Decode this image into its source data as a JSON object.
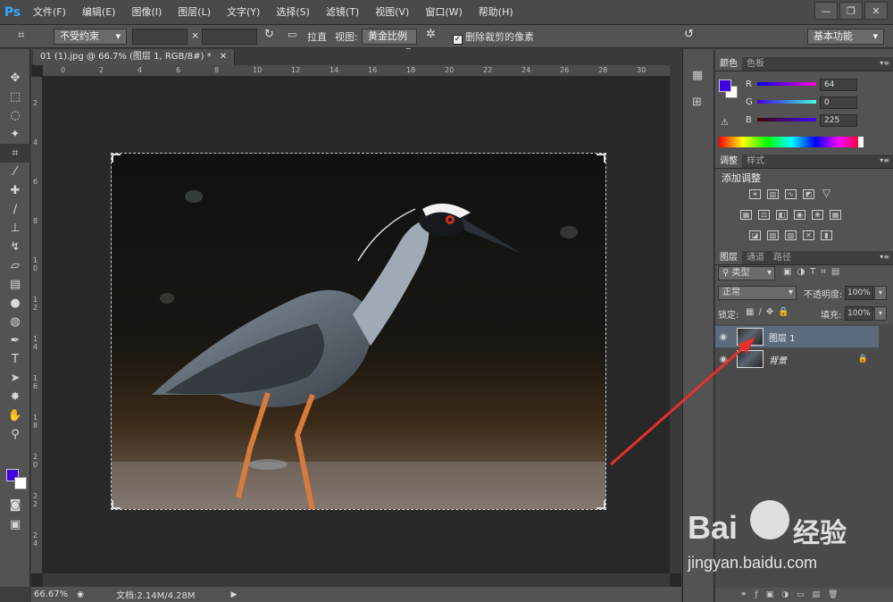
{
  "menubar": {
    "logo": "Ps",
    "items": [
      "文件(F)",
      "编辑(E)",
      "图像(I)",
      "图层(L)",
      "文字(Y)",
      "选择(S)",
      "滤镜(T)",
      "视图(V)",
      "窗口(W)",
      "帮助(H)"
    ],
    "win_minimize": "—",
    "win_restore": "❐",
    "win_close": "✕"
  },
  "options": {
    "ratio_select": "不受约束",
    "x_sep": "×",
    "straighten_label": "拉直",
    "view_label": "视图:",
    "view_select": "黄金比例",
    "delete_pixels_label": "删除裁剪的像素",
    "delete_pixels_checked": true,
    "workspace_select": "基本功能"
  },
  "document": {
    "tab_title": "01 (1).jpg @ 66.7% (图层 1, RGB/8#) *",
    "tab_close": "✕",
    "ruler_h": [
      "0",
      "2",
      "4",
      "6",
      "8",
      "10",
      "12",
      "14",
      "16",
      "18",
      "20",
      "22",
      "24",
      "26",
      "28",
      "30"
    ],
    "ruler_v": [
      "2",
      "4",
      "6",
      "8",
      "1 0",
      "1 2",
      "1 4",
      "1 6",
      "1 8",
      "2 0",
      "2 2",
      "2 4"
    ]
  },
  "status": {
    "zoom": "66.67%",
    "doc_info": "文档:2.14M/4.28M"
  },
  "color_panel": {
    "tabs": [
      "颜色",
      "色板"
    ],
    "r_label": "R",
    "r_value": "64",
    "g_label": "G",
    "g_value": "0",
    "b_label": "B",
    "b_value": "225",
    "foreground": "#4000e1",
    "background": "#ffffff"
  },
  "adjust_panel": {
    "tabs": [
      "调整",
      "样式"
    ],
    "title": "添加调整"
  },
  "layers_panel": {
    "tabs": [
      "图层",
      "通道",
      "路径"
    ],
    "filter_select": "类型",
    "blend_select": "正常",
    "opacity_label": "不透明度:",
    "opacity_value": "100%",
    "lock_label": "锁定:",
    "fill_label": "填充:",
    "fill_value": "100%",
    "layers": [
      {
        "name": "图层 1",
        "selected": true
      },
      {
        "name": "背景",
        "selected": false,
        "locked": true
      }
    ]
  },
  "watermark": {
    "brand": "Bai",
    "brand2": "经验",
    "url": "jingyan.baidu.com"
  }
}
